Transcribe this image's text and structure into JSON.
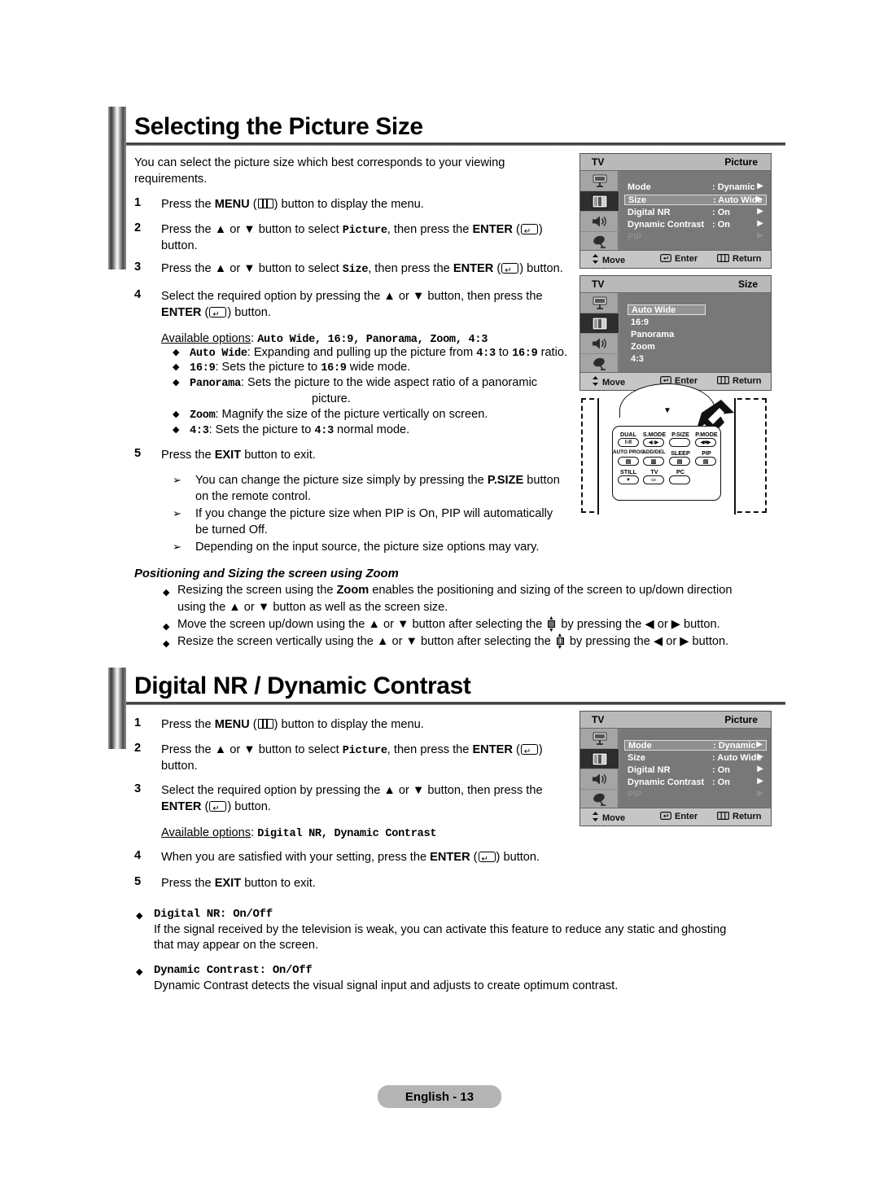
{
  "document": {
    "footer_label": "English - 13"
  },
  "section1": {
    "heading": "Selecting the Picture Size",
    "intro": "You can select the picture size which best corresponds to your viewing requirements.",
    "steps": [
      {
        "num": "1",
        "parts": [
          "Press the ",
          "MENU",
          " (",
          "MENU-ICON",
          ") button to display the menu."
        ]
      },
      {
        "num": "2",
        "parts": [
          "Press the ▲ or ▼ button to select ",
          "Picture",
          ", then press the ",
          "ENTER",
          " (",
          "ENTER-ICON",
          ") button."
        ]
      },
      {
        "num": "3",
        "parts": [
          "Press the ▲ or ▼ button to select ",
          "Size",
          ", then press the ",
          "ENTER",
          " (",
          "ENTER-ICON",
          ") button."
        ]
      },
      {
        "num": "4",
        "parts": [
          "Select the required option by pressing the ▲ or ▼ button, then press the ",
          "ENTER",
          " (",
          "ENTER-ICON",
          ") button."
        ]
      },
      {
        "num": "5",
        "parts": [
          "Press the ",
          "EXIT",
          " button to exit."
        ]
      }
    ],
    "step1_text_a": "Press the ",
    "step1_bold": "MENU",
    "step1_text_b": ") button to display the menu.",
    "step2_text_a": "Press the ▲ or ▼ button to select ",
    "step2_mono": "Picture",
    "step2_text_b": ", then press the ",
    "step2_bold": "ENTER",
    "step2_text_c": ")",
    "step2_line2": "button.",
    "step3_text_a": "Press the ▲ or ▼ button to select ",
    "step3_mono": "Size",
    "step3_text_b": ", then press the ",
    "step3_bold": "ENTER",
    "step3_text_c": ") button.",
    "step4_text_a": "Select the required option by pressing the ▲ or ▼ button, then press the",
    "step4_bold": "ENTER",
    "step4_text_b": ") button.",
    "step5_text_a": "Press the ",
    "step5_bold": "EXIT",
    "step5_text_b": " button to exit.",
    "available_label": "Available options",
    "available_colon": ":",
    "available_options": "Auto Wide, 16:9, Panorama, Zoom, 4:3",
    "option_bullets": [
      {
        "term": "Auto Wide",
        "desc_a": ": Expanding and pulling up the picture from ",
        "mono1": "4:3",
        "desc_b": " to ",
        "mono2": "16:9",
        "desc_c": " ratio."
      },
      {
        "term": "16:9",
        "desc_a": ": Sets the picture to ",
        "mono1": "16:9",
        "desc_b": " wide mode.",
        "mono2": "",
        "desc_c": ""
      },
      {
        "term": "Panorama",
        "desc_a": ": Sets the picture to the wide aspect ratio of a panoramic",
        "mono1": "",
        "desc_b": "",
        "mono2": "",
        "desc_c": ""
      },
      {
        "term": "Zoom",
        "desc_a": ": Magnify the size of the picture vertically on screen.",
        "mono1": "",
        "desc_b": "",
        "mono2": "",
        "desc_c": ""
      },
      {
        "term": "4:3",
        "desc_a": ": Sets the picture to ",
        "mono1": "4:3",
        "desc_b": " normal mode.",
        "mono2": "",
        "desc_c": ""
      }
    ],
    "panorama_wrap": "picture.",
    "notes": [
      {
        "line1_a": "You can change the picture size simply by pressing the ",
        "line1_bold": "P.SIZE",
        "line1_b": " button",
        "line2": "on the remote control."
      },
      {
        "line1_a": "If you change the picture size when PIP is On, PIP will automatically",
        "line1_bold": "",
        "line1_b": "",
        "line2": "be turned Off."
      },
      {
        "line1_a": "Depending on the input source, the picture size options may vary.",
        "line1_bold": "",
        "line1_b": "",
        "line2": ""
      }
    ],
    "zoom_subheading": "Positioning and Sizing the screen using Zoom",
    "zoom_bullets": [
      {
        "a": "Resizing the screen using the ",
        "bold": "Zoom",
        "b": " enables the positioning and sizing of the screen to up/down direction",
        "line2": "using the ▲ or ▼ button as well as the screen size.",
        "icon": ""
      },
      {
        "a": "Move the screen up/down using the ▲ or ▼ button after selecting the ",
        "bold": "",
        "b": " by pressing the ◀ or ▶ button.",
        "line2": "",
        "icon": "move-icon"
      },
      {
        "a": "Resize the screen vertically using the ▲ or ▼ button after selecting the ",
        "bold": "",
        "b": " by pressing the ◀ or ▶ button.",
        "line2": "",
        "icon": "size-icon"
      }
    ]
  },
  "section2": {
    "heading": "Digital NR / Dynamic Contrast",
    "step1_text_a": "Press the ",
    "step1_bold": "MENU",
    "step1_text_b": ") button to display the menu.",
    "step2_text_a": "Press the ▲ or ▼ button to select ",
    "step2_mono": "Picture",
    "step2_text_b": ", then press the ",
    "step2_bold": "ENTER",
    "step2_text_c": ")",
    "step2_line2": "button.",
    "step3_text_a": "Select the required option by pressing the ▲ or ▼ button, then press the",
    "step3_bold": "ENTER",
    "step3_text_b": ") button.",
    "available_label": "Available options",
    "available_colon": ":",
    "available_options": "Digital NR, Dynamic Contrast",
    "step4_text_a": "When you are satisfied with your setting, press the ",
    "step4_bold": "ENTER",
    "step4_text_b": ") button.",
    "step5_text_a": "Press the ",
    "step5_bold": "EXIT",
    "step5_text_b": " button to exit.",
    "features": [
      {
        "title": "Digital NR: On/Off",
        "line1": "If the signal received by the television is weak, you can activate this feature to reduce any static and ghosting",
        "line2": "that may appear on the screen."
      },
      {
        "title": "Dynamic Contrast: On/Off",
        "line1": "Dynamic Contrast detects the visual signal input and adjusts to create optimum contrast.",
        "line2": ""
      }
    ]
  },
  "osd_picture_1": {
    "tv_label": "TV",
    "title": "Picture",
    "rows": [
      {
        "key": "Mode",
        "value": ": Dynamic",
        "arrow": "▶",
        "selected": false,
        "dim": false
      },
      {
        "key": "Size",
        "value": ": Auto Wide",
        "arrow": "▶",
        "selected": true,
        "dim": false
      },
      {
        "key": "Digital NR",
        "value": ": On",
        "arrow": "▶",
        "selected": false,
        "dim": false
      },
      {
        "key": "Dynamic Contrast",
        "value": ": On",
        "arrow": "▶",
        "selected": false,
        "dim": false
      },
      {
        "key": "PIP",
        "value": "",
        "arrow": "▶",
        "selected": false,
        "dim": true
      }
    ],
    "footer": {
      "move": "Move",
      "enter": "Enter",
      "return": "Return"
    }
  },
  "osd_size": {
    "tv_label": "TV",
    "title": "Size",
    "options": [
      {
        "label": "Auto Wide",
        "selected": true
      },
      {
        "label": "16:9",
        "selected": false
      },
      {
        "label": "Panorama",
        "selected": false
      },
      {
        "label": "Zoom",
        "selected": false
      },
      {
        "label": "4:3",
        "selected": false
      }
    ],
    "footer": {
      "move": "Move",
      "enter": "Enter",
      "return": "Return"
    }
  },
  "osd_picture_2": {
    "tv_label": "TV",
    "title": "Picture",
    "rows": [
      {
        "key": "Mode",
        "value": ": Dynamic",
        "arrow": "▶",
        "selected": true,
        "dim": false
      },
      {
        "key": "Size",
        "value": ": Auto Wide",
        "arrow": "▶",
        "selected": false,
        "dim": false
      },
      {
        "key": "Digital NR",
        "value": ": On",
        "arrow": "▶",
        "selected": false,
        "dim": false
      },
      {
        "key": "Dynamic Contrast",
        "value": ": On",
        "arrow": "▶",
        "selected": false,
        "dim": false
      },
      {
        "key": "PIP",
        "value": "",
        "arrow": "▶",
        "selected": false,
        "dim": true
      }
    ],
    "footer": {
      "move": "Move",
      "enter": "Enter",
      "return": "Return"
    }
  },
  "remote": {
    "rows": [
      {
        "labels": [
          "DUAL",
          "S.MODE",
          "P.SIZE",
          "P.MODE"
        ],
        "glyphs": [
          "I-II",
          "◀♪▶",
          "",
          "◀■▶"
        ]
      },
      {
        "labels": [
          "AUTO PROG.",
          "ADD/DEL",
          "SLEEP",
          "PIP"
        ],
        "glyphs": [
          "▤",
          "▥",
          "▤",
          "▤"
        ]
      },
      {
        "labels": [
          "STILL",
          "TV",
          "PC"
        ],
        "glyphs": [
          "▼",
          "▭",
          ""
        ]
      }
    ]
  },
  "colors": {
    "osd_background": "#787878",
    "osd_sidebar": "#a5a5a5",
    "osd_title": "#b9b9b9",
    "osd_footer": "#c6c6c6",
    "footer_badge": "#b4b4b4"
  }
}
